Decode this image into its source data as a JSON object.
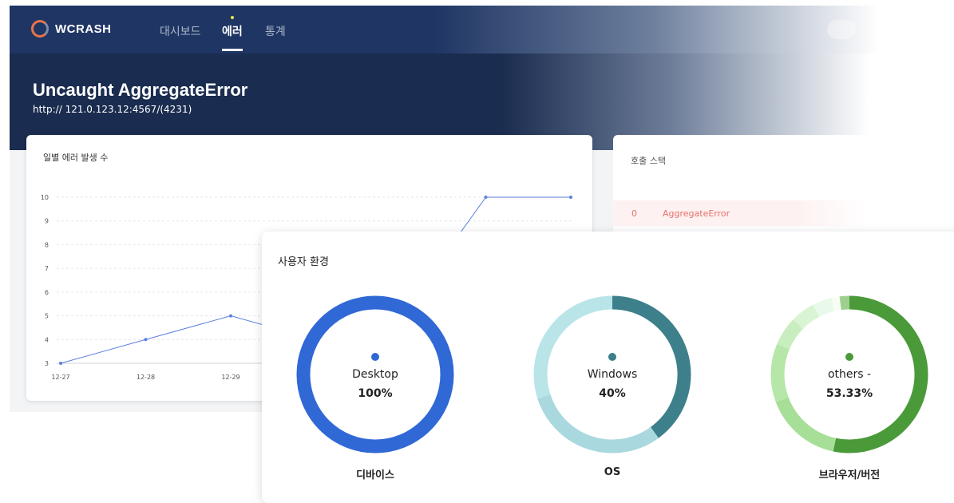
{
  "nav": {
    "brand": "WCRASH",
    "items": [
      {
        "label": "대시보드",
        "active": false
      },
      {
        "label": "에러",
        "active": true
      },
      {
        "label": "통계",
        "active": false
      }
    ]
  },
  "header": {
    "title": "Uncaught AggregateError",
    "url": "http:// 121.0.123.12:4567/(4231)"
  },
  "daily_errors": {
    "title": "일별 에러 발생 수"
  },
  "chart_data": {
    "type": "line",
    "title": "일별 에러 발생 수",
    "x": [
      "12-27",
      "12-28",
      "12-29",
      "",
      "",
      "",
      ""
    ],
    "x_tick_labels": [
      "12-27",
      "12-28",
      "12-29"
    ],
    "y_ticks": [
      3,
      4,
      5,
      6,
      7,
      8,
      9,
      10
    ],
    "ylim": [
      3,
      10
    ],
    "series": [
      {
        "values": [
          3,
          4,
          5,
          4,
          5,
          10,
          10
        ],
        "color": "#5b7fe4"
      }
    ],
    "grid": true
  },
  "call_stack": {
    "title": "호출 스택",
    "rows": [
      {
        "index": "0",
        "name": "AggregateError"
      }
    ]
  },
  "user_env": {
    "title": "사용자 환경",
    "donuts": [
      {
        "caption": "디바이스",
        "name": "Desktop",
        "percent": "100%",
        "dot_color": "#3068d6",
        "slices": [
          {
            "label": "Desktop",
            "value": 100,
            "color": "#3068d6"
          }
        ]
      },
      {
        "caption": "OS",
        "name": "Windows",
        "percent": "40%",
        "dot_color": "#3d7f8b",
        "slices": [
          {
            "label": "Windows",
            "value": 40,
            "color": "#3d7f8b"
          },
          {
            "label": "",
            "value": 30,
            "color": "#a9d8de"
          },
          {
            "label": "",
            "value": 30,
            "color": "#b9e5e8"
          }
        ]
      },
      {
        "caption": "브라우저/버전",
        "name": "others -",
        "percent": "53.33%",
        "dot_color": "#4a9a3a",
        "slices": [
          {
            "label": "others -",
            "value": 53.33,
            "color": "#4a9a3a"
          },
          {
            "label": "",
            "value": 16,
            "color": "#a8df98"
          },
          {
            "label": "",
            "value": 12,
            "color": "#b6e6a8"
          },
          {
            "label": "",
            "value": 6,
            "color": "#c8edbe"
          },
          {
            "label": "",
            "value": 5,
            "color": "#d9f4d2"
          },
          {
            "label": "",
            "value": 4,
            "color": "#eafaea"
          },
          {
            "label": "",
            "value": 1.67,
            "color": "#f7fdf5"
          },
          {
            "label": "",
            "value": 2,
            "color": "#9fcf8f"
          }
        ]
      }
    ]
  }
}
